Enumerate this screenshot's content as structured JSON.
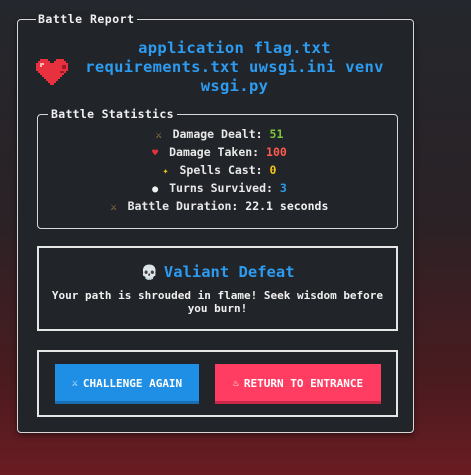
{
  "panel": {
    "title": "Battle Report",
    "headline": "application flag.txt requirements.txt uwsgi.ini venv wsgi.py",
    "heart_icon": "pixel-heart-icon"
  },
  "stats": {
    "title": "Battle Statistics",
    "rows": [
      {
        "icon": "⚔",
        "label": "Damage Dealt:",
        "value": "51",
        "color": "#7ac53c"
      },
      {
        "icon": "♥",
        "label": "Damage Taken:",
        "value": "100",
        "color": "#ff5a4e"
      },
      {
        "icon": "✦",
        "label": "Spells Cast:",
        "value": "0",
        "color": "#f4c418"
      },
      {
        "icon": "●",
        "label": "Turns Survived:",
        "value": "3",
        "color": "#2d9cf0"
      },
      {
        "icon": "⚔",
        "label": "Battle Duration:",
        "value": "22.1 seconds",
        "color": "#f0f0f0"
      }
    ]
  },
  "defeat": {
    "icon": "💀",
    "title": "Valiant Defeat",
    "message": "Your path is shrouded in flame! Seek wisdom before you burn!"
  },
  "actions": {
    "challenge": {
      "icon": "⚔",
      "label": "CHALLENGE AGAIN"
    },
    "return": {
      "icon": "♨",
      "label": "RETURN TO ENTRANCE"
    }
  },
  "colors": {
    "accent_blue": "#2d9cf0",
    "danger_red": "#ff3d62",
    "panel_bg": "#212429"
  }
}
